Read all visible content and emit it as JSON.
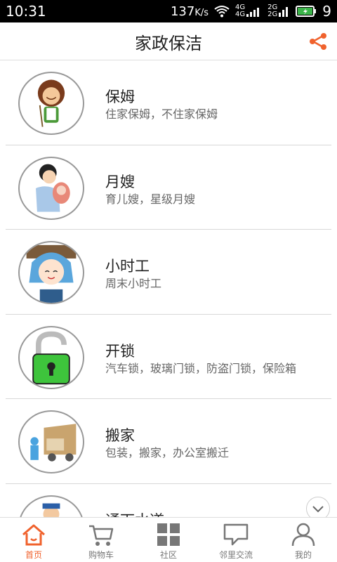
{
  "status_bar": {
    "time": "10:31",
    "speed": "137",
    "speed_unit": "K/s",
    "net_4g_a": "4G",
    "net_4g_b": "4G",
    "net_2g_a": "2G",
    "net_2g_b": "2G",
    "battery_level": "9"
  },
  "header": {
    "title": "家政保洁",
    "share_icon": "share-icon"
  },
  "colors": {
    "accent": "#f0622d",
    "battery": "#3bb44a"
  },
  "services": [
    {
      "name": "保姆",
      "desc": "住家保姆，不住家保姆"
    },
    {
      "name": "月嫂",
      "desc": "育儿嫂，星级月嫂"
    },
    {
      "name": "小时工",
      "desc": "周末小时工"
    },
    {
      "name": "开锁",
      "desc": "汽车锁，玻璃门锁，防盗门锁，保险箱"
    },
    {
      "name": "搬家",
      "desc": "包装，搬家，办公室搬迁"
    },
    {
      "name": "通下水道",
      "desc": ""
    }
  ],
  "tabs": [
    {
      "label": "首页",
      "icon": "home-icon",
      "active": true
    },
    {
      "label": "购物车",
      "icon": "cart-icon"
    },
    {
      "label": "社区",
      "icon": "grid-icon"
    },
    {
      "label": "邻里交流",
      "icon": "chat-icon"
    },
    {
      "label": "我的",
      "icon": "person-icon"
    }
  ]
}
